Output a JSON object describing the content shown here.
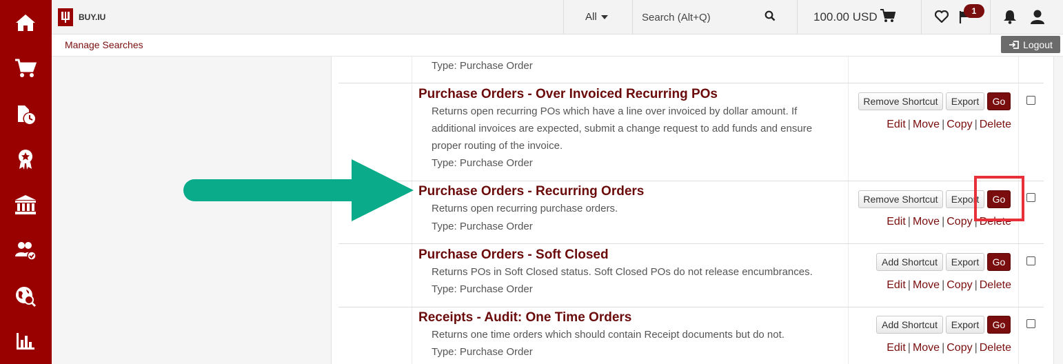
{
  "brand": {
    "name": "BUY.IU",
    "color": "#990000"
  },
  "header": {
    "scope_label": "All",
    "search_placeholder": "Search (Alt+Q)",
    "cart_total": "100.00 USD",
    "notification_badge": "1"
  },
  "subbar": {
    "manage_searches": "Manage Searches",
    "logout_label": "Logout"
  },
  "sidebar": {
    "icons": [
      "home-icon",
      "cart-icon",
      "documents-clock-icon",
      "award-icon",
      "bank-icon",
      "users-check-icon",
      "globe-search-icon",
      "bar-chart-icon"
    ]
  },
  "rows": [
    {
      "type": "Type: Purchase Order"
    },
    {
      "title": "Purchase Orders - Over Invoiced Recurring POs",
      "desc": "Returns open recurring POs which have a line over invoiced by dollar amount. If additional invoices are expected, submit a change request to add funds and ensure proper routing of the invoice.",
      "type": "Type: Purchase Order",
      "shortcut": "Remove Shortcut",
      "export": "Export",
      "go": "Go",
      "links": [
        "Edit",
        "Move",
        "Copy",
        "Delete"
      ]
    },
    {
      "title": "Purchase Orders - Recurring Orders",
      "desc": "Returns open recurring purchase orders.",
      "type": "Type: Purchase Order",
      "shortcut": "Remove Shortcut",
      "export": "Export",
      "go": "Go",
      "links": [
        "Edit",
        "Move",
        "Copy",
        "Delete"
      ]
    },
    {
      "title": "Purchase Orders - Soft Closed",
      "desc": "Returns POs in Soft Closed status. Soft Closed POs do not release encumbrances.",
      "type": "Type: Purchase Order",
      "shortcut": "Add Shortcut",
      "export": "Export",
      "go": "Go",
      "links": [
        "Edit",
        "Move",
        "Copy",
        "Delete"
      ]
    },
    {
      "title": "Receipts - Audit: One Time Orders",
      "desc": "Returns one time orders which should contain Receipt documents but do not.",
      "type": "Type: Purchase Order",
      "shortcut": "Add Shortcut",
      "export": "Export",
      "go": "Go",
      "links": [
        "Edit",
        "Move",
        "Copy",
        "Delete"
      ]
    }
  ],
  "annotation": {
    "arrow_color": "#0aab8a",
    "highlight_color": "#e8303a"
  }
}
